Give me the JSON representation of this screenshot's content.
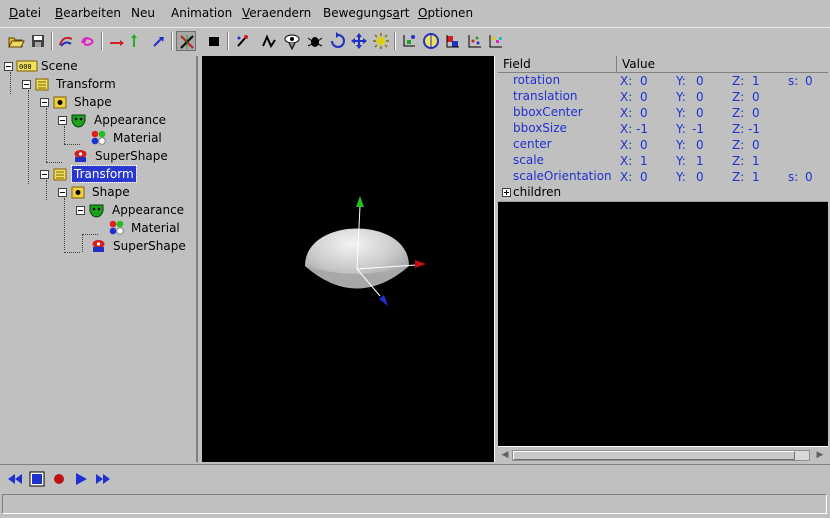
{
  "menu": {
    "items": [
      {
        "pre": "",
        "u": "D",
        "post": "atei"
      },
      {
        "pre": "",
        "u": "B",
        "post": "earbeiten"
      },
      {
        "pre": "Neu",
        "u": "",
        "post": ""
      },
      {
        "pre": "Animation",
        "u": "",
        "post": ""
      },
      {
        "pre": "",
        "u": "V",
        "post": "eraendern"
      },
      {
        "pre": "Bewegungs",
        "u": "a",
        "post": "rt"
      },
      {
        "pre": "",
        "u": "O",
        "post": "ptionen"
      }
    ]
  },
  "toolbar": {
    "icons": [
      "open-icon",
      "save-icon",
      "scene-graph-icon",
      "spiral-icon",
      "translate-x-icon",
      "translate-y-icon",
      "translate-z-icon",
      "cut-transform-icon",
      "stop-icon",
      "tool-icon",
      "bend-icon",
      "view-icon",
      "bug-icon",
      "rotate-icon",
      "move-icon",
      "light-icon",
      "axis-icon",
      "sphere-icon",
      "color-icon",
      "points-icon",
      "palette-icon"
    ]
  },
  "tree": {
    "nodes": [
      {
        "label": "Scene",
        "icon": "scene-icon"
      },
      {
        "label": "Transform",
        "icon": "transform-icon"
      },
      {
        "label": "Shape",
        "icon": "shape-icon"
      },
      {
        "label": "Appearance",
        "icon": "appearance-icon"
      },
      {
        "label": "Material",
        "icon": "material-icon"
      },
      {
        "label": "SuperShape",
        "icon": "supershape-icon"
      },
      {
        "label": "Transform",
        "icon": "transform-icon"
      },
      {
        "label": "Shape",
        "icon": "shape-icon"
      },
      {
        "label": "Appearance",
        "icon": "appearance-icon"
      },
      {
        "label": "Material",
        "icon": "material-icon"
      },
      {
        "label": "SuperShape",
        "icon": "supershape-icon"
      }
    ],
    "selected_index": 6
  },
  "fields": {
    "header_field": "Field",
    "header_value": "Value",
    "rows": [
      {
        "name": "rotation",
        "v": [
          "X:",
          "0",
          "Y:",
          "0",
          "Z:",
          "1",
          "s:",
          "0"
        ]
      },
      {
        "name": "translation",
        "v": [
          "X:",
          "0",
          "Y:",
          "0",
          "Z:",
          "0"
        ]
      },
      {
        "name": "bboxCenter",
        "v": [
          "X:",
          "0",
          "Y:",
          "0",
          "Z:",
          "0"
        ]
      },
      {
        "name": "bboxSize",
        "v": [
          "X:",
          "-1",
          "Y:",
          "-1",
          "Z:",
          "-1"
        ]
      },
      {
        "name": "center",
        "v": [
          "X:",
          "0",
          "Y:",
          "0",
          "Z:",
          "0"
        ]
      },
      {
        "name": "scale",
        "v": [
          "X:",
          "1",
          "Y:",
          "1",
          "Z:",
          "1"
        ]
      },
      {
        "name": "scaleOrientation",
        "v": [
          "X:",
          "0",
          "Y:",
          "0",
          "Z:",
          "1",
          "s:",
          "0"
        ]
      }
    ],
    "children_label": "children"
  },
  "playback": {
    "icons": [
      "rewind-icon",
      "stop-icon",
      "record-icon",
      "play-icon",
      "fast-forward-icon"
    ]
  },
  "status": {
    "text": ""
  },
  "colors": {
    "selection": "#2838d0",
    "field_text": "#2030d0",
    "viewport_bg": "#000000"
  }
}
